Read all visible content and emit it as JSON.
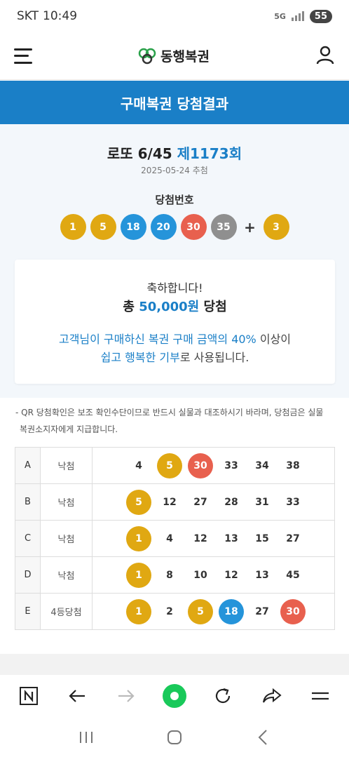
{
  "status_bar": {
    "carrier": "SKT",
    "time": "10:49",
    "network": "5G",
    "battery": "55"
  },
  "header": {
    "brand": "동행복권"
  },
  "banner": {
    "title": "구매복권 당첨결과"
  },
  "draw": {
    "game": "로또 6/45",
    "round": "제1173회",
    "date": "2025-05-24 추첨",
    "winning_label": "당첨번호",
    "numbers": [
      {
        "value": "1",
        "color": "#e0a812"
      },
      {
        "value": "5",
        "color": "#e0a812"
      },
      {
        "value": "18",
        "color": "#2594da"
      },
      {
        "value": "20",
        "color": "#2594da"
      },
      {
        "value": "30",
        "color": "#e8604e"
      },
      {
        "value": "35",
        "color": "#8f8f8f"
      }
    ],
    "plus": "+",
    "bonus": {
      "value": "3",
      "color": "#e0a812"
    }
  },
  "result_card": {
    "congrats": "축하합니다!",
    "total_prefix": "총",
    "total_amount": "50,000원",
    "total_suffix": "당첨",
    "donation_line1_a": "고객님이 구매하신 복권 구매 금액의 40%",
    "donation_line1_b": " 이상이",
    "donation_line2_a": "쉽고 행복한 기부",
    "donation_line2_b": "로 사용됩니다."
  },
  "notice": {
    "line1": "- QR 당첨확인은 보조 확인수단이므로 반드시 실물과 대조하시기 바라며, 당첨금은 실물",
    "line2": "복권소지자에게 지급합니다."
  },
  "ticket_lines": [
    {
      "line": "A",
      "result": "낙첨",
      "numbers": [
        {
          "v": "4",
          "ball": false
        },
        {
          "v": "5",
          "ball": true,
          "color": "#e0a812"
        },
        {
          "v": "30",
          "ball": true,
          "color": "#e8604e"
        },
        {
          "v": "33",
          "ball": false
        },
        {
          "v": "34",
          "ball": false
        },
        {
          "v": "38",
          "ball": false
        }
      ]
    },
    {
      "line": "B",
      "result": "낙첨",
      "numbers": [
        {
          "v": "5",
          "ball": true,
          "color": "#e0a812"
        },
        {
          "v": "12",
          "ball": false
        },
        {
          "v": "27",
          "ball": false
        },
        {
          "v": "28",
          "ball": false
        },
        {
          "v": "31",
          "ball": false
        },
        {
          "v": "33",
          "ball": false
        }
      ]
    },
    {
      "line": "C",
      "result": "낙첨",
      "numbers": [
        {
          "v": "1",
          "ball": true,
          "color": "#e0a812"
        },
        {
          "v": "4",
          "ball": false
        },
        {
          "v": "12",
          "ball": false
        },
        {
          "v": "13",
          "ball": false
        },
        {
          "v": "15",
          "ball": false
        },
        {
          "v": "27",
          "ball": false
        }
      ]
    },
    {
      "line": "D",
      "result": "낙첨",
      "numbers": [
        {
          "v": "1",
          "ball": true,
          "color": "#e0a812"
        },
        {
          "v": "8",
          "ball": false
        },
        {
          "v": "10",
          "ball": false
        },
        {
          "v": "12",
          "ball": false
        },
        {
          "v": "13",
          "ball": false
        },
        {
          "v": "45",
          "ball": false
        }
      ]
    },
    {
      "line": "E",
      "result": "4등당첨",
      "numbers": [
        {
          "v": "1",
          "ball": true,
          "color": "#e0a812"
        },
        {
          "v": "2",
          "ball": false
        },
        {
          "v": "5",
          "ball": true,
          "color": "#e0a812"
        },
        {
          "v": "18",
          "ball": true,
          "color": "#2594da"
        },
        {
          "v": "27",
          "ball": false
        },
        {
          "v": "30",
          "ball": true,
          "color": "#e8604e"
        }
      ]
    }
  ],
  "browser_nav": {
    "icons": [
      "naver-n-icon",
      "back-arrow-icon",
      "forward-arrow-icon",
      "home-green-icon",
      "refresh-icon",
      "share-icon",
      "menu-icon"
    ]
  },
  "system_nav": {
    "icons": [
      "recent-apps-icon",
      "home-icon",
      "back-icon"
    ]
  }
}
